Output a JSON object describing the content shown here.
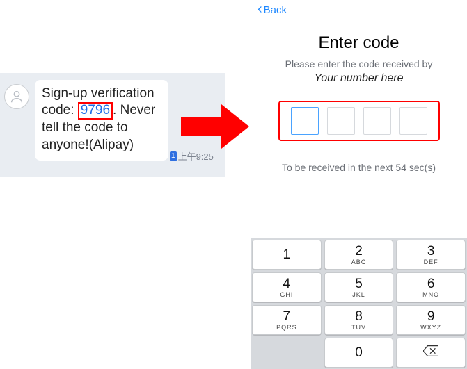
{
  "sms": {
    "text_before": "Sign-up verification code: ",
    "code": "9796",
    "text_after": ". Never tell the code to anyone!(Alipay)",
    "sim_badge": "1",
    "time": "上午9:25"
  },
  "back_label": "Back",
  "title": "Enter code",
  "subtitle": "Please enter the code received by",
  "number_placeholder": "Your number here",
  "countdown": "To be received in the next 54 sec(s)",
  "keypad": {
    "k1": {
      "d": "1",
      "l": ""
    },
    "k2": {
      "d": "2",
      "l": "ABC"
    },
    "k3": {
      "d": "3",
      "l": "DEF"
    },
    "k4": {
      "d": "4",
      "l": "GHI"
    },
    "k5": {
      "d": "5",
      "l": "JKL"
    },
    "k6": {
      "d": "6",
      "l": "MNO"
    },
    "k7": {
      "d": "7",
      "l": "PQRS"
    },
    "k8": {
      "d": "8",
      "l": "TUV"
    },
    "k9": {
      "d": "9",
      "l": "WXYZ"
    },
    "k0": {
      "d": "0",
      "l": ""
    }
  }
}
